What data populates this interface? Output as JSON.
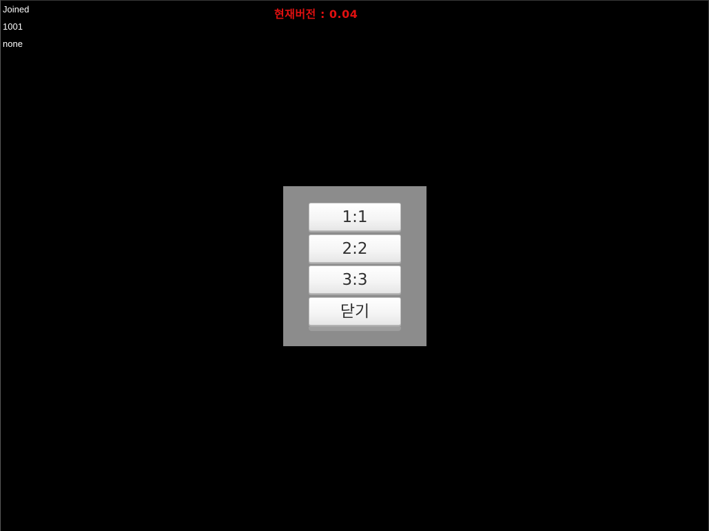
{
  "debug": {
    "status": "Joined",
    "room_id": "1001",
    "extra": "none"
  },
  "version_label": "현재버전  : 0.04",
  "match_menu": {
    "buttons": [
      {
        "label": "1:1"
      },
      {
        "label": "2:2"
      },
      {
        "label": "3:3"
      },
      {
        "label": "닫기"
      }
    ]
  },
  "colors": {
    "background": "#000000",
    "panel": "#8c8c8c",
    "version_text": "#e01010",
    "debug_text": "#ffffff"
  }
}
